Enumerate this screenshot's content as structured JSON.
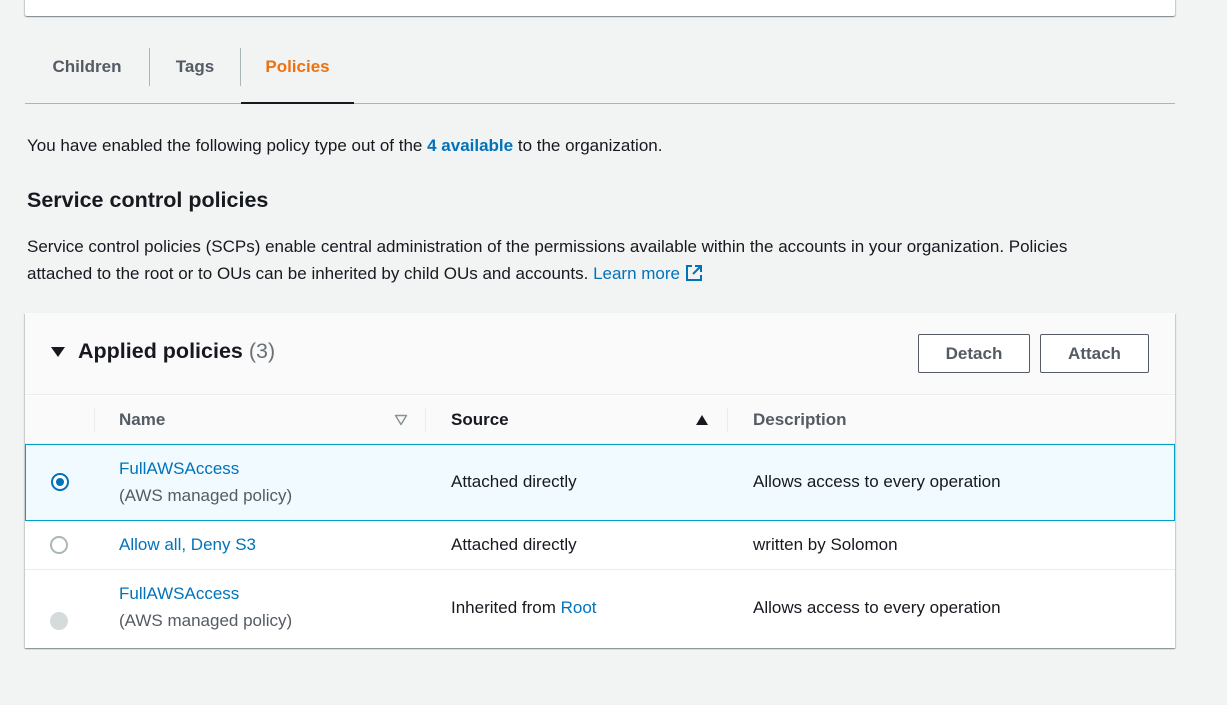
{
  "tabs": [
    {
      "label": "Children"
    },
    {
      "label": "Tags"
    },
    {
      "label": "Policies",
      "active": true
    }
  ],
  "intro": {
    "before": "You have enabled the following policy type out of the ",
    "link": "4 available",
    "after": " to the organization."
  },
  "section": {
    "title": "Service control policies",
    "description": "Service control policies (SCPs) enable central administration of the permissions available within the accounts in your organization. Policies attached to the root or to OUs can be inherited by child OUs and accounts.",
    "learn_more": "Learn more"
  },
  "panel": {
    "title": "Applied policies",
    "count": "(3)",
    "detach_label": "Detach",
    "attach_label": "Attach"
  },
  "table": {
    "columns": {
      "name": "Name",
      "source": "Source",
      "description": "Description"
    },
    "sort": {
      "name": "none",
      "source": "ascending"
    },
    "rows": [
      {
        "name": "FullAWSAccess",
        "subtitle": "(AWS managed policy)",
        "source": "Attached directly",
        "source_link": "",
        "description": "Allows access to every operation",
        "state": "selected"
      },
      {
        "name": "Allow all, Deny S3",
        "subtitle": "",
        "source": "Attached directly",
        "source_link": "",
        "description": "written by Solomon",
        "state": "unselected"
      },
      {
        "name": "FullAWSAccess",
        "subtitle": "(AWS managed policy)",
        "source": "Inherited from ",
        "source_link": "Root",
        "description": "Allows access to every operation",
        "state": "disabled"
      }
    ]
  },
  "colors": {
    "accent": "#ec7211",
    "link": "#0073bb",
    "selection_border": "#00a1c9",
    "selection_bg": "#f1faff"
  },
  "icons": [
    "caret-down-icon",
    "sort-neutral-icon",
    "sort-ascending-icon",
    "external-link-icon"
  ]
}
